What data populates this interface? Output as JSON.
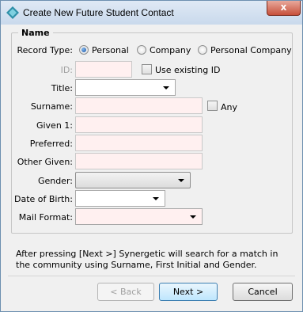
{
  "window": {
    "title": "Create New Future Student Contact",
    "close_glyph": "x"
  },
  "group": {
    "legend": "Name"
  },
  "record_type": {
    "label": "Record Type:",
    "options": [
      "Personal",
      "Company",
      "Personal Company"
    ],
    "selected": "Personal"
  },
  "id_field": {
    "label": "ID:",
    "value": "",
    "use_existing_label": "Use existing ID"
  },
  "title_field": {
    "label": "Title:",
    "value": ""
  },
  "surname": {
    "label": "Surname:",
    "value": "",
    "any_label": "Any"
  },
  "given1": {
    "label": "Given 1:",
    "value": ""
  },
  "preferred": {
    "label": "Preferred:",
    "value": ""
  },
  "other_given": {
    "label": "Other Given:",
    "value": ""
  },
  "gender": {
    "label": "Gender:",
    "value": ""
  },
  "dob": {
    "label": "Date of Birth:",
    "value": ""
  },
  "mail_format": {
    "label": "Mail Format:",
    "value": ""
  },
  "info_text": "After pressing [Next >] Synergetic will search for a match in the community using Surname, First Initial and Gender.",
  "buttons": {
    "back": "< Back",
    "next": "Next >",
    "cancel": "Cancel"
  },
  "colors": {
    "required_field_bg": "#fff0f0",
    "default_button": "#bee6fd"
  }
}
